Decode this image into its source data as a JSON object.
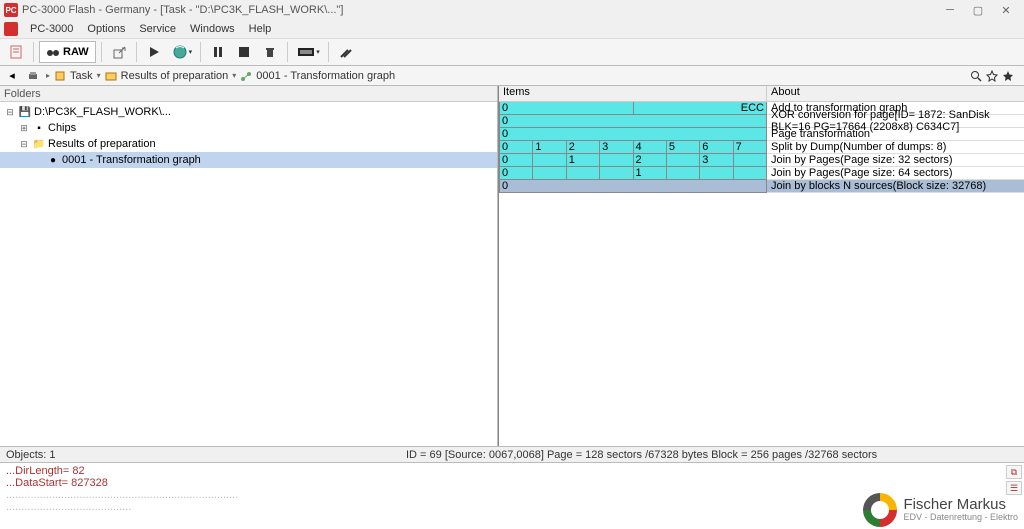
{
  "window": {
    "app_icon_text": "PC",
    "title": "PC-3000 Flash - Germany - [Task - \"D:\\PC3K_FLASH_WORK\\...\"]"
  },
  "menu": {
    "items": [
      "PC-3000",
      "Options",
      "Service",
      "Windows",
      "Help"
    ]
  },
  "raw_button": "RAW",
  "breadcrumb": {
    "task": "Task",
    "results": "Results of preparation",
    "graph": "0001 - Transformation graph"
  },
  "folders": {
    "header": "Folders",
    "root": "D:\\PC3K_FLASH_WORK\\...",
    "chips": "Chips",
    "results": "Results of preparation",
    "graph": "0001 - Transformation graph"
  },
  "rightpanel": {
    "col_items": "Items",
    "col_about": "About",
    "rows": [
      {
        "cells": [
          "0"
        ],
        "ecc": "ECC",
        "about": "Add to transformation graph"
      },
      {
        "cells": [
          "0"
        ],
        "about": "XOR conversion for page[ID= 1872: SanDisk BLK=16 PG=17664 (2208x8) C634C7]"
      },
      {
        "cells": [
          "0"
        ],
        "about": "Page transformation"
      },
      {
        "cells": [
          "0",
          "1",
          "2",
          "3",
          "4",
          "5",
          "6",
          "7"
        ],
        "about": "Split by Dump(Number of dumps: 8)"
      },
      {
        "cells": [
          "0",
          "",
          "1",
          "",
          "2",
          "",
          "3",
          ""
        ],
        "about": "Join by Pages(Page size: 32 sectors)"
      },
      {
        "cells": [
          "0",
          "",
          "",
          "",
          "1",
          "",
          "",
          ""
        ],
        "about": "Join by Pages(Page size: 64 sectors)"
      },
      {
        "cells": [
          "0"
        ],
        "about": "Join by blocks N sources(Block size: 32768)",
        "sel": true
      }
    ]
  },
  "status": {
    "left": "Objects: 1",
    "right": "ID = 69 [Source: 0067,0068] Page = 128 sectors /67328 bytes  Block = 256 pages /32768 sectors"
  },
  "log": {
    "l1": "...DirLength= 82",
    "l2": "...DataStart= 827328",
    "l3_gray": "............................................................................",
    "l4_gray": "........................................."
  },
  "watermark": {
    "name": "Fischer Markus",
    "sub": "EDV - Datenrettung - Elektro"
  }
}
